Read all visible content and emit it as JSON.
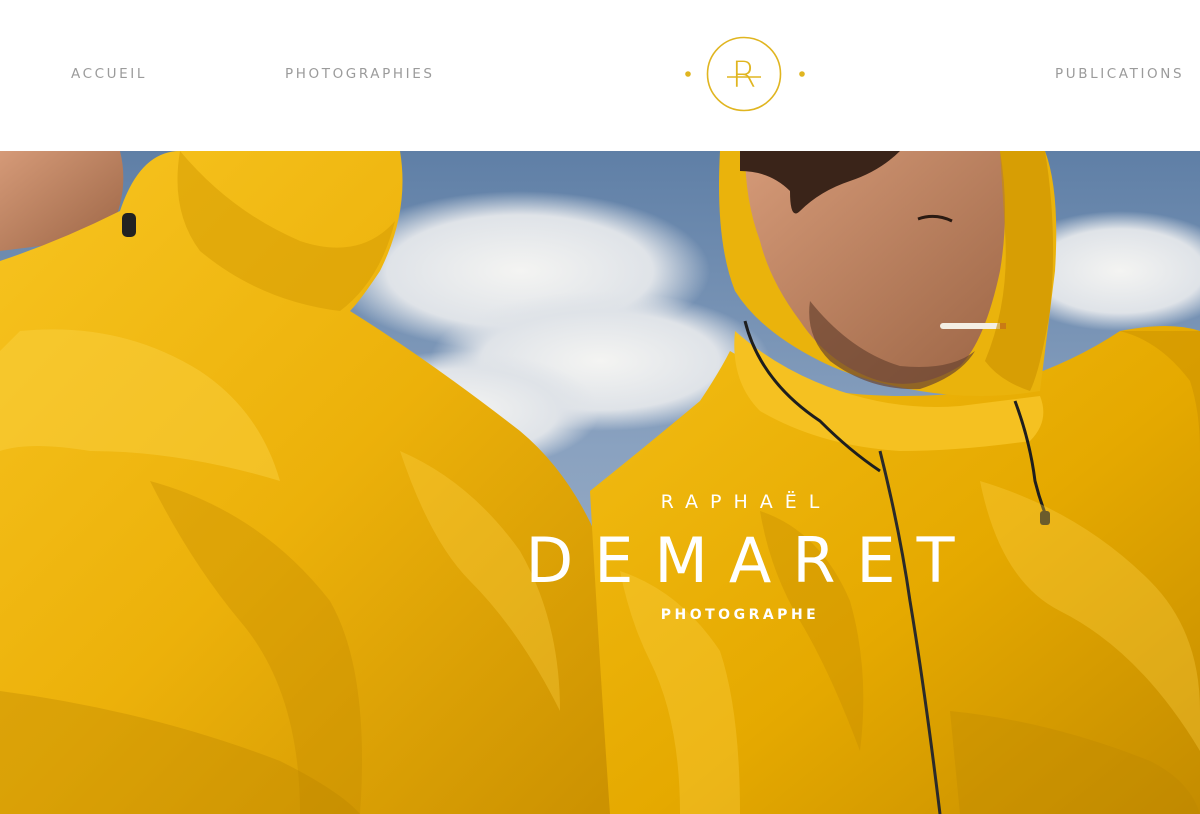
{
  "nav": {
    "accueil": "ACCUEIL",
    "photographies": "PHOTOGRAPHIES",
    "publications": "PUBLICATIONS"
  },
  "logo": {
    "letter": "R",
    "color": "#e0b520",
    "icon": "monogram-r-circle-icon"
  },
  "hero": {
    "first_name": "RAPHAËL",
    "last_name": "DEMARET",
    "role": "PHOTOGRAPHE",
    "image": "two-men-in-yellow-raincoats-photo"
  },
  "colors": {
    "nav_text": "#9b9b9b",
    "accent": "#e0b520",
    "raincoat_yellow": "#f0b70b",
    "sky_blue": "#6f8fb5"
  }
}
